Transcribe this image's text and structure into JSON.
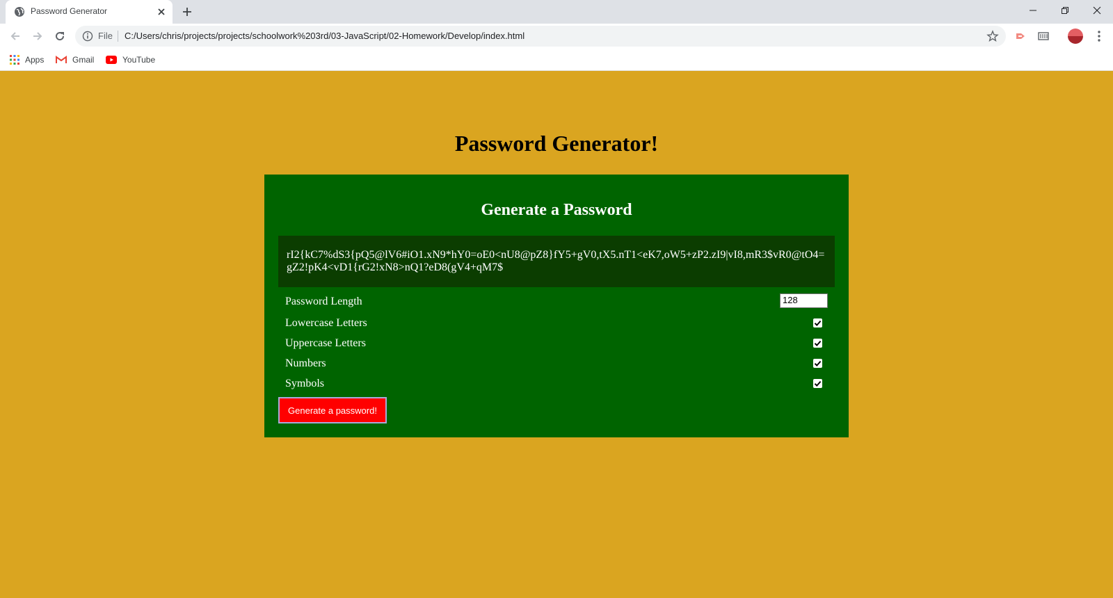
{
  "browser": {
    "tab_title": "Password Generator",
    "file_label": "File",
    "url": "C:/Users/chris/projects/projects/schoolwork%203rd/03-JavaScript/02-Homework/Develop/index.html",
    "bookmarks": [
      "Apps",
      "Gmail",
      "YouTube"
    ]
  },
  "page": {
    "heading": "Password Generator!",
    "card": {
      "title": "Generate a Password",
      "password": "rI2{kC7%dS3{pQ5@lV6#iO1.xN9*hY0=oE0<nU8@pZ8}fY5+gV0,tX5.nT1<eK7,oW5+zP2.zI9|vI8,mR3$vR0@tO4=gZ2!pK4<vD1{rG2!xN8>nQ1?eD8(gV4+qM7$",
      "length_label": "Password Length",
      "length_value": "128",
      "options": [
        {
          "label": "Lowercase Letters",
          "checked": true
        },
        {
          "label": "Uppercase Letters",
          "checked": true
        },
        {
          "label": "Numbers",
          "checked": true
        },
        {
          "label": "Symbols",
          "checked": true
        }
      ],
      "button_label": "Generate a password!"
    }
  },
  "colors": {
    "page_bg": "#DAA520",
    "card_bg": "#006400",
    "password_bg": "#0B3D00",
    "button_bg": "#FF0000"
  }
}
